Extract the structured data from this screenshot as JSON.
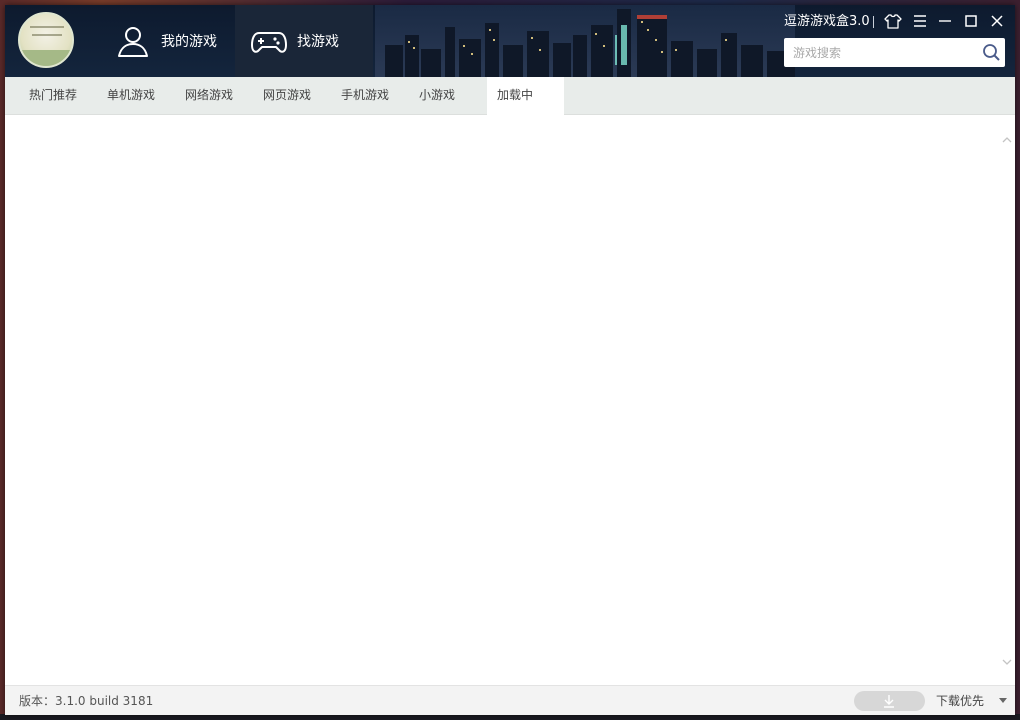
{
  "app": {
    "title": "逗游游戏盒3.0",
    "nav": [
      {
        "label": "我的游戏",
        "icon": "user-icon"
      },
      {
        "label": "找游戏",
        "icon": "gamepad-icon"
      }
    ],
    "controls": [
      "skin-icon",
      "menu-icon",
      "minimize-icon",
      "maximize-icon",
      "close-icon"
    ],
    "search": {
      "placeholder": "游戏搜索",
      "value": "",
      "icon": "search-icon"
    }
  },
  "categories": {
    "tabs": [
      {
        "label": "热门推荐"
      },
      {
        "label": "单机游戏"
      },
      {
        "label": "网络游戏"
      },
      {
        "label": "网页游戏"
      },
      {
        "label": "手机游戏"
      },
      {
        "label": "小游戏"
      },
      {
        "label": "加载中"
      }
    ],
    "active": "加载中"
  },
  "status": {
    "version": "版本：3.1.0 build 3181",
    "download_icon": "download-icon",
    "download_mode": "下载优先"
  },
  "colors": {
    "titlebar": "#14253d",
    "active_nav": "#1a2638",
    "catbar": "#e8ecea",
    "accent": "#ffffff"
  }
}
